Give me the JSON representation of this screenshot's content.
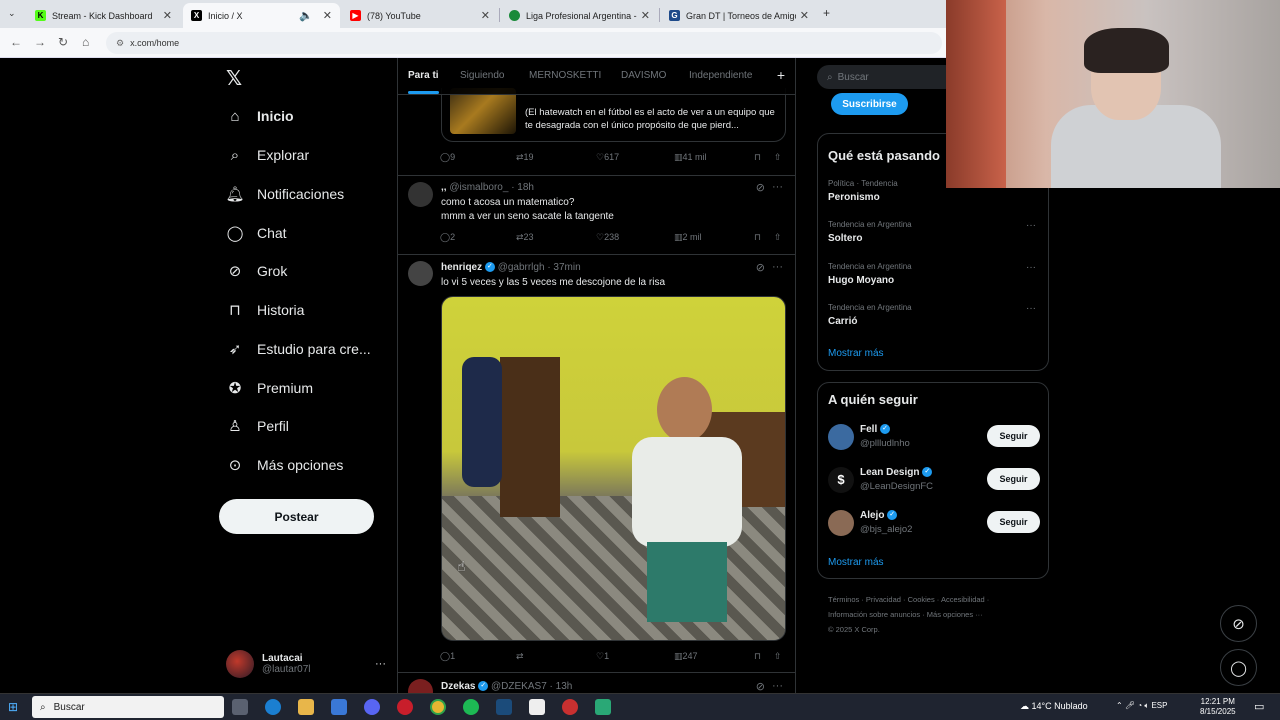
{
  "browser": {
    "tabs": [
      {
        "title": "Stream - Kick Dashboard",
        "icon": "kick-icon",
        "color": "#53fc18"
      },
      {
        "title": "Inicio / X",
        "icon": "x-icon",
        "color": "#000000"
      },
      {
        "title": "(78) YouTube",
        "icon": "youtube-icon",
        "color": "#ff0000"
      },
      {
        "title": "Liga Profesional Argentina - PO",
        "icon": "liga-icon",
        "color": "#1a8a3a"
      },
      {
        "title": "Gran DT | Torneos de Amigos",
        "icon": "grandt-icon",
        "color": "#1e4a8a"
      }
    ],
    "new_tab": "+",
    "url": "x.com/home"
  },
  "sidebar": {
    "logo": "𝕏",
    "items": [
      {
        "label": "Inicio",
        "icon": "home-icon"
      },
      {
        "label": "Explorar",
        "icon": "search-icon"
      },
      {
        "label": "Notificaciones",
        "icon": "bell-icon"
      },
      {
        "label": "Chat",
        "icon": "chat-icon"
      },
      {
        "label": "Grok",
        "icon": "grok-icon"
      },
      {
        "label": "Historia",
        "icon": "bookmark-icon"
      },
      {
        "label": "Estudio para cre...",
        "icon": "rocket-icon"
      },
      {
        "label": "Premium",
        "icon": "verified-icon"
      },
      {
        "label": "Perfil",
        "icon": "person-icon"
      },
      {
        "label": "Más opciones",
        "icon": "more-icon"
      }
    ],
    "post_label": "Postear",
    "account": {
      "name": "Lautacai",
      "handle": "@lautar07l",
      "more": "···"
    }
  },
  "feed": {
    "tabs": [
      "Para ti",
      "Siguiendo",
      "MERNOSKETTI",
      "DAVISMO",
      "Independiente"
    ],
    "tab_add": "+",
    "tweets": [
      {
        "card_text": "(El hatewatch en el fútbol es el acto de ver a un equipo que te desagrada con el único propósito de que pierd...",
        "replies": "9",
        "reposts": "19",
        "likes": "617",
        "views": "41 mil"
      },
      {
        "name": ",,",
        "handle": "@ismalboro_",
        "time": "· 18h",
        "text1": "como t acosa un matematico?",
        "text2": "mmm a ver un seno sacate la tangente",
        "replies": "2",
        "reposts": "23",
        "likes": "238",
        "views": "2 mil"
      },
      {
        "name": "henriqez",
        "handle": "@gabrrlgh",
        "time": "· 37min",
        "text1": "lo vi 5 veces y las 5 veces me descojone de la risa",
        "replies": "1",
        "reposts": "",
        "likes": "1",
        "views": "247"
      },
      {
        "name": "Dzekas",
        "handle": "@DZEKAS7",
        "time": "· 13h"
      }
    ]
  },
  "right": {
    "search_placeholder": "Buscar",
    "subscribe_label": "Suscribirse",
    "trends_title": "Qué está pasando",
    "trends": [
      {
        "meta": "Política · Tendencia",
        "name": "Peronismo"
      },
      {
        "meta": "Tendencia en Argentina",
        "name": "Soltero"
      },
      {
        "meta": "Tendencia en Argentina",
        "name": "Hugo Moyano"
      },
      {
        "meta": "Tendencia en Argentina",
        "name": "Carrió"
      }
    ],
    "trends_more": "Mostrar más",
    "follow_title": "A quién seguir",
    "follow": [
      {
        "name": "Fell",
        "handle": "@pllludlnho",
        "button": "Seguir"
      },
      {
        "name": "Lean Design",
        "handle": "@LeanDesignFC",
        "button": "Seguir"
      },
      {
        "name": "Alejo",
        "handle": "@bjs_alejo2",
        "button": "Seguir"
      }
    ],
    "follow_more": "Mostrar más",
    "footer_line1": "Términos · Privacidad · Cookies · Accesibilidad ·",
    "footer_line2": "Información sobre anuncios · Más opciones ···",
    "footer_line3": "© 2025 X Corp."
  },
  "taskbar": {
    "search_label": "Buscar",
    "weather": "14°C  Nublado",
    "lang": "ESP",
    "time": "12:21 PM",
    "date": "8/15/2025"
  },
  "colors": {
    "accent": "#1d9bf0",
    "background": "#000000",
    "border": "#2f3336",
    "muted": "#71767b"
  }
}
